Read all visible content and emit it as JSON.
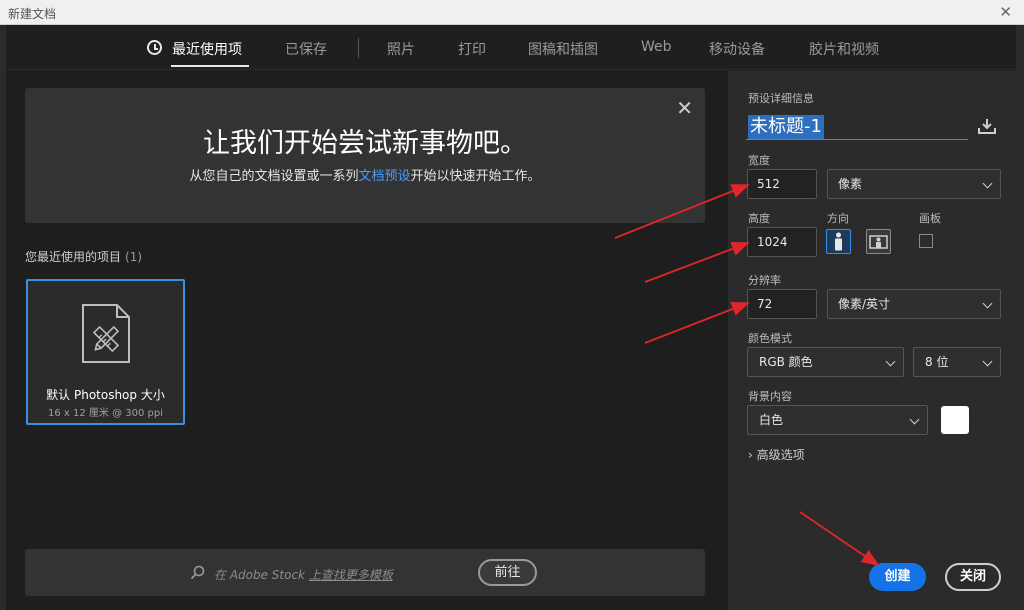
{
  "window": {
    "title": "新建文档",
    "close_glyph": "✕"
  },
  "tabs": [
    {
      "label": "最近使用项",
      "active": true
    },
    {
      "label": "已保存",
      "active": false
    },
    {
      "label": "照片",
      "active": false
    },
    {
      "label": "打印",
      "active": false
    },
    {
      "label": "图稿和插图",
      "active": false
    },
    {
      "label": "Web",
      "active": false
    },
    {
      "label": "移动设备",
      "active": false
    },
    {
      "label": "胶片和视频",
      "active": false
    }
  ],
  "hero": {
    "title": "让我们开始尝试新事物吧。",
    "subtitle_pre": "从您自己的文档设置或一系列",
    "subtitle_link": "文档预设",
    "subtitle_post": "开始以快速开始工作。",
    "close_glyph": "✕"
  },
  "recent": {
    "label": "您最近使用的项目",
    "count": "(1)",
    "items": [
      {
        "name": "默认 Photoshop 大小",
        "size": "16 x 12 厘米 @ 300 ppi"
      }
    ]
  },
  "stock": {
    "search_pre": "在 Adobe Stock ",
    "search_underline": "上查找更多模板",
    "go_label": "前往"
  },
  "preset_details": {
    "section_label": "预设详细信息",
    "document_name": "未标题-1",
    "width_label": "宽度",
    "width_value": "512",
    "width_unit": "像素",
    "height_label": "高度",
    "height_value": "1024",
    "orientation_label": "方向",
    "orientation": "portrait",
    "artboard_label": "画板",
    "artboard_checked": false,
    "resolution_label": "分辨率",
    "resolution_value": "72",
    "resolution_unit": "像素/英寸",
    "color_mode_label": "颜色模式",
    "color_mode": "RGB 颜色",
    "bit_depth": "8 位",
    "background_label": "背景内容",
    "background": "白色",
    "background_color": "#ffffff",
    "advanced_label": "高级选项",
    "advanced_glyph": "›"
  },
  "actions": {
    "create_label": "创建",
    "close_label": "关闭"
  },
  "colors": {
    "accent": "#1473e6",
    "link": "#4a9ff5",
    "annotation_arrow": "#e0262b",
    "panel_bg": "#2b2b2b",
    "main_bg": "#1e1e1e"
  }
}
